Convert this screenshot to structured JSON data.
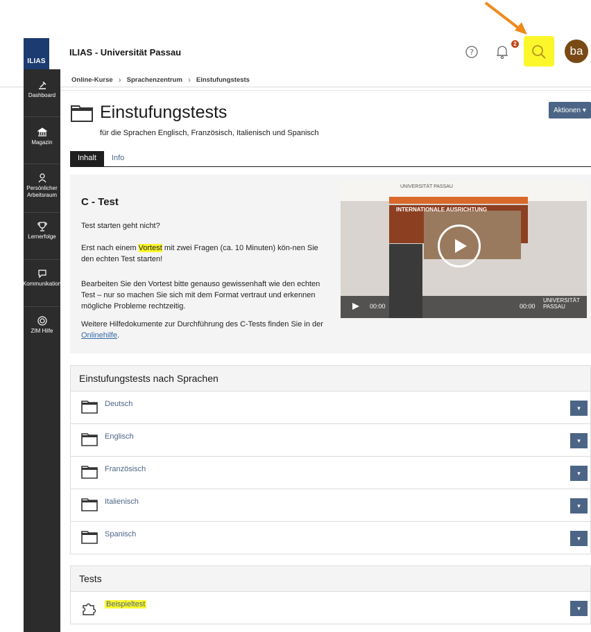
{
  "header": {
    "logo_text": "ILIAS",
    "app_title": "ILIAS - Universität Passau",
    "notification_count": "2",
    "avatar_initials": "ba"
  },
  "sidebar": {
    "items": [
      {
        "label": "Dashboard",
        "icon": "dashboard-icon"
      },
      {
        "label": "Magazin",
        "icon": "library-icon"
      },
      {
        "label": "Persönlicher Arbeitsraum",
        "icon": "person-icon"
      },
      {
        "label": "Lernerfolge",
        "icon": "trophy-icon"
      },
      {
        "label": "Kommunikation",
        "icon": "chat-icon"
      },
      {
        "label": "ZIM Hilfe",
        "icon": "lifebuoy-icon"
      }
    ]
  },
  "breadcrumb": [
    "Online-Kurse",
    "Sprachenzentrum",
    "Einstufungstests"
  ],
  "page": {
    "title": "Einstufungstests",
    "subtitle": "für die Sprachen Englisch, Französisch, Italienisch und Spanisch",
    "actions_label": "Aktionen"
  },
  "tabs": [
    {
      "label": "Inhalt",
      "active": true
    },
    {
      "label": "Info",
      "active": false
    }
  ],
  "info": {
    "heading": "C - Test",
    "p1": "Test starten geht nicht?",
    "p2_pre": "Erst nach einem ",
    "p2_hl": "Vortest",
    "p2_post": " mit zwei Fragen (ca. 10 Minuten) kön-nen Sie den echten Test starten!",
    "p3": "Bearbeiten Sie den Vortest bitte genauso gewissenhaft wie den echten Test – nur so machen Sie sich mit dem Format vertraut und erkennen mögliche Probleme rechtzeitig.",
    "p4_pre": "Weitere Hilfedokumente zur Durchführung des C-Tests finden Sie in der ",
    "p4_link": "Onlinehilfe",
    "p4_post": "."
  },
  "video": {
    "logo_text": "UNIVERSITÄT PASSAU",
    "banner_text": "INTERNATIONALE AUSRICHTUNG",
    "time_current": "00:00",
    "time_total": "00:00",
    "corner_logo": "UNIVERSITÄT PASSAU"
  },
  "languages_panel": {
    "title": "Einstufungstests nach Sprachen",
    "items": [
      "Deutsch",
      "Englisch",
      "Französisch",
      "Italienisch",
      "Spanisch"
    ]
  },
  "tests_panel": {
    "title": "Tests",
    "items": [
      "Beispieltest"
    ]
  },
  "colors": {
    "accent": "#4c6586",
    "sidebar": "#2c2c2c",
    "highlight": "#fbf72b",
    "arrow": "#f08a1c"
  }
}
